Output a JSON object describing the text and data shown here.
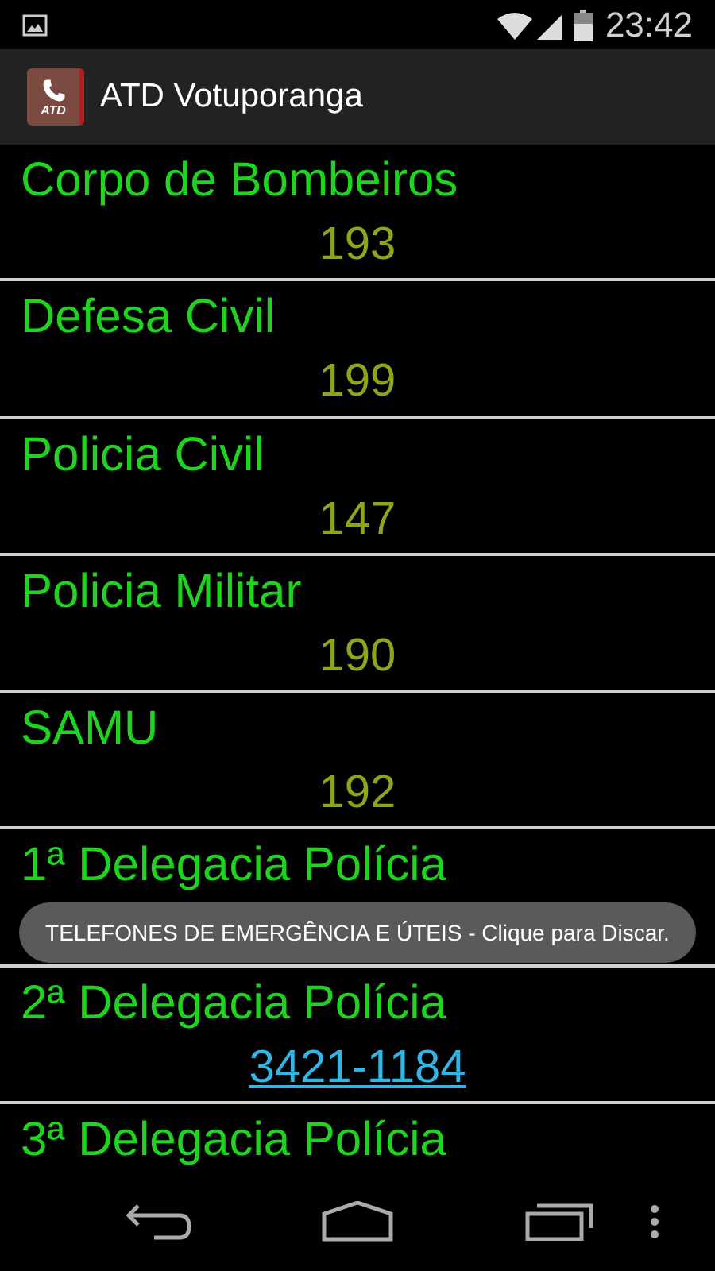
{
  "status_bar": {
    "time": "23:42"
  },
  "app_bar": {
    "title": "ATD Votuporanga",
    "icon_text": "ATD"
  },
  "contacts": [
    {
      "name": "Corpo de Bombeiros",
      "number": "193",
      "linked": false
    },
    {
      "name": "Defesa Civil",
      "number": "199",
      "linked": false
    },
    {
      "name": "Policia Civil",
      "number": "147",
      "linked": false
    },
    {
      "name": "Policia Militar",
      "number": "190",
      "linked": false
    },
    {
      "name": "SAMU",
      "number": "192",
      "linked": false
    },
    {
      "name": "1ª Delegacia Polícia"
    },
    {
      "name": "2ª Delegacia Polícia",
      "number": "3421-1184",
      "linked": true
    },
    {
      "name": "3ª Delegacia Polícia"
    }
  ],
  "toast": {
    "message": "TELEFONES DE EMERGÊNCIA E ÚTEIS - Clique para Discar."
  }
}
